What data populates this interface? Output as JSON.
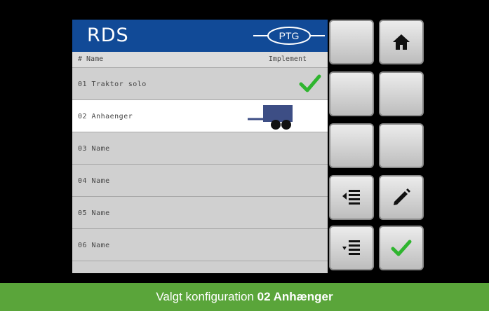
{
  "header": {
    "title": "RDS",
    "logo_text": "PTG"
  },
  "columns": {
    "name": "# Name",
    "implement": "Implement"
  },
  "rows": [
    {
      "label": "01 Traktor solo",
      "status": "active-check"
    },
    {
      "label": "02 Anhaenger",
      "status": "trailer-icon",
      "selected": true
    },
    {
      "label": "03 Name"
    },
    {
      "label": "04 Name"
    },
    {
      "label": "05 Name"
    },
    {
      "label": "06 Name"
    }
  ],
  "buttons": [
    "home-icon",
    "empty",
    "empty",
    "empty",
    "empty",
    "empty",
    "move-up-icon",
    "edit-icon",
    "move-down-icon",
    "confirm-icon"
  ],
  "footer": {
    "prefix": "Valgt konfiguration",
    "value": "02 Anhænger"
  },
  "colors": {
    "header": "#114a97",
    "footer": "#5aa53a",
    "check": "#2fb52f"
  }
}
